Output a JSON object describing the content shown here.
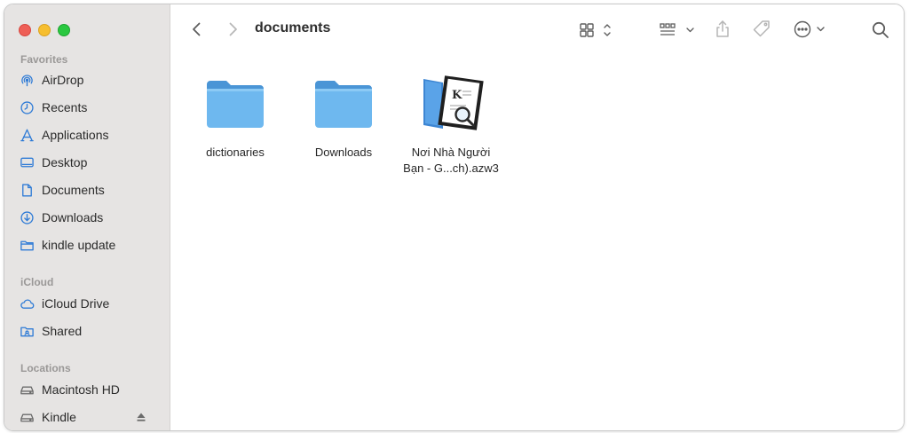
{
  "window": {
    "title": "documents"
  },
  "sidebar": {
    "favorites": {
      "title": "Favorites",
      "items": [
        {
          "label": "AirDrop",
          "icon": "airdrop-icon"
        },
        {
          "label": "Recents",
          "icon": "clock-icon"
        },
        {
          "label": "Applications",
          "icon": "applications-icon"
        },
        {
          "label": "Desktop",
          "icon": "desktop-icon"
        },
        {
          "label": "Documents",
          "icon": "document-icon"
        },
        {
          "label": "Downloads",
          "icon": "download-icon"
        },
        {
          "label": "kindle update",
          "icon": "folder-icon"
        }
      ]
    },
    "icloud": {
      "title": "iCloud",
      "items": [
        {
          "label": "iCloud Drive",
          "icon": "cloud-icon"
        },
        {
          "label": "Shared",
          "icon": "shared-folder-icon"
        }
      ]
    },
    "locations": {
      "title": "Locations",
      "items": [
        {
          "label": "Macintosh HD",
          "icon": "disk-icon"
        },
        {
          "label": "Kindle",
          "icon": "disk-icon"
        }
      ]
    }
  },
  "files": [
    {
      "name": "dictionaries",
      "type": "folder"
    },
    {
      "name": "Downloads",
      "type": "folder"
    },
    {
      "name_line1": "Nơi Nhà Người",
      "name_line2": "Bạn - G...ch).azw3",
      "type": "ebook"
    }
  ],
  "colors": {
    "accent": "#2f7bd6",
    "folder": "#6eb8ef",
    "sidebar_bg": "#e6e4e3"
  }
}
